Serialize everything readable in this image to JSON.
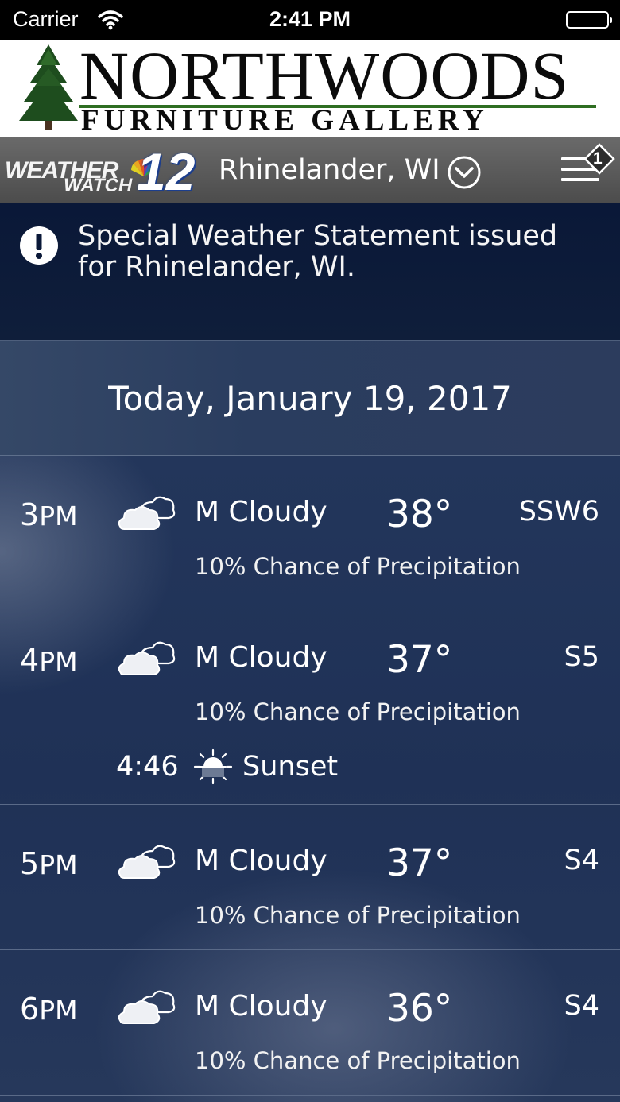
{
  "status_bar": {
    "carrier": "Carrier",
    "time": "2:41 PM"
  },
  "ad": {
    "line1": "NORTHWOODS",
    "line2": "FURNITURE GALLERY"
  },
  "header": {
    "logo_word1": "WEATHER",
    "logo_word2": "WATCH",
    "logo_number": "12",
    "location": "Rhinelander, WI",
    "menu_badge": "1"
  },
  "alert": {
    "text": "Special Weather Statement issued for Rhinelander, WI."
  },
  "day": {
    "title": "Today, January 19, 2017"
  },
  "hourly": [
    {
      "hour": "3",
      "ampm": "PM",
      "condition": "M Cloudy",
      "temp": "38°",
      "wind": "SSW6",
      "precip": "10% Chance of Precipitation"
    },
    {
      "hour": "4",
      "ampm": "PM",
      "condition": "M Cloudy",
      "temp": "37°",
      "wind": "S5",
      "precip": "10% Chance of Precipitation",
      "sun_time": "4:46",
      "sun_label": "Sunset"
    },
    {
      "hour": "5",
      "ampm": "PM",
      "condition": "M Cloudy",
      "temp": "37°",
      "wind": "S4",
      "precip": "10% Chance of Precipitation"
    },
    {
      "hour": "6",
      "ampm": "PM",
      "condition": "M Cloudy",
      "temp": "36°",
      "wind": "S4",
      "precip": "10% Chance of Precipitation"
    }
  ],
  "icons": {
    "wifi": "wifi-icon",
    "battery": "battery-icon",
    "tree": "pine-tree-icon",
    "chevron": "chevron-down-circle-icon",
    "menu": "hamburger-menu-icon",
    "alert": "exclamation-circle-icon",
    "cloud": "cloud-icon",
    "sunset": "sunset-icon"
  },
  "colors": {
    "alert_bg": "#0a1838",
    "header_bg": "#5a5a5a",
    "ad_green": "#2f6e22",
    "logo_blue": "#1d3f8d"
  }
}
